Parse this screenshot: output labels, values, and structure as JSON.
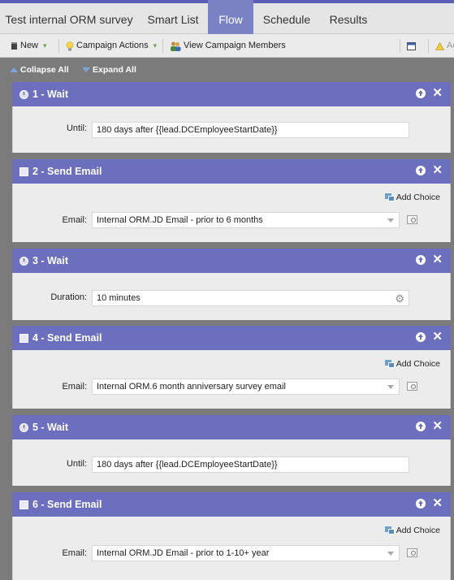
{
  "tabs": [
    {
      "label": "Test internal ORM survey"
    },
    {
      "label": "Smart List"
    },
    {
      "label": "Flow"
    },
    {
      "label": "Schedule"
    },
    {
      "label": "Results"
    }
  ],
  "active_tab": "Flow",
  "toolbar": {
    "new_label": "New",
    "campaign_actions_label": "Campaign Actions",
    "view_members_label": "View Campaign Members",
    "truncated_label": "Ac"
  },
  "controls": {
    "collapse_all": "Collapse All",
    "expand_all": "Expand All"
  },
  "steps": [
    {
      "title": "1 - Wait",
      "type": "wait",
      "field_label": "Until:",
      "value": "180 days after {{lead.DCEmployeeStartDate}}"
    },
    {
      "title": "2 - Send Email",
      "type": "email",
      "add_choice": "Add Choice",
      "field_label": "Email:",
      "value": "Internal ORM.JD Email - prior to 6 months"
    },
    {
      "title": "3 - Wait",
      "type": "wait",
      "field_label": "Duration:",
      "value": "10 minutes"
    },
    {
      "title": "4 - Send Email",
      "type": "email",
      "add_choice": "Add Choice",
      "field_label": "Email:",
      "value": "Internal ORM.6 month anniversary survey email"
    },
    {
      "title": "5 - Wait",
      "type": "wait",
      "field_label": "Until:",
      "value": "180 days after {{lead.DCEmployeeStartDate}}"
    },
    {
      "title": "6 - Send Email",
      "type": "email",
      "add_choice": "Add Choice",
      "field_label": "Email:",
      "value": "Internal ORM.JD Email - prior to 1-10+ year"
    }
  ],
  "colors": {
    "step_header": "#6b6fbd",
    "active_tab": "#7a82c4",
    "canvas": "#7b7b7b"
  }
}
